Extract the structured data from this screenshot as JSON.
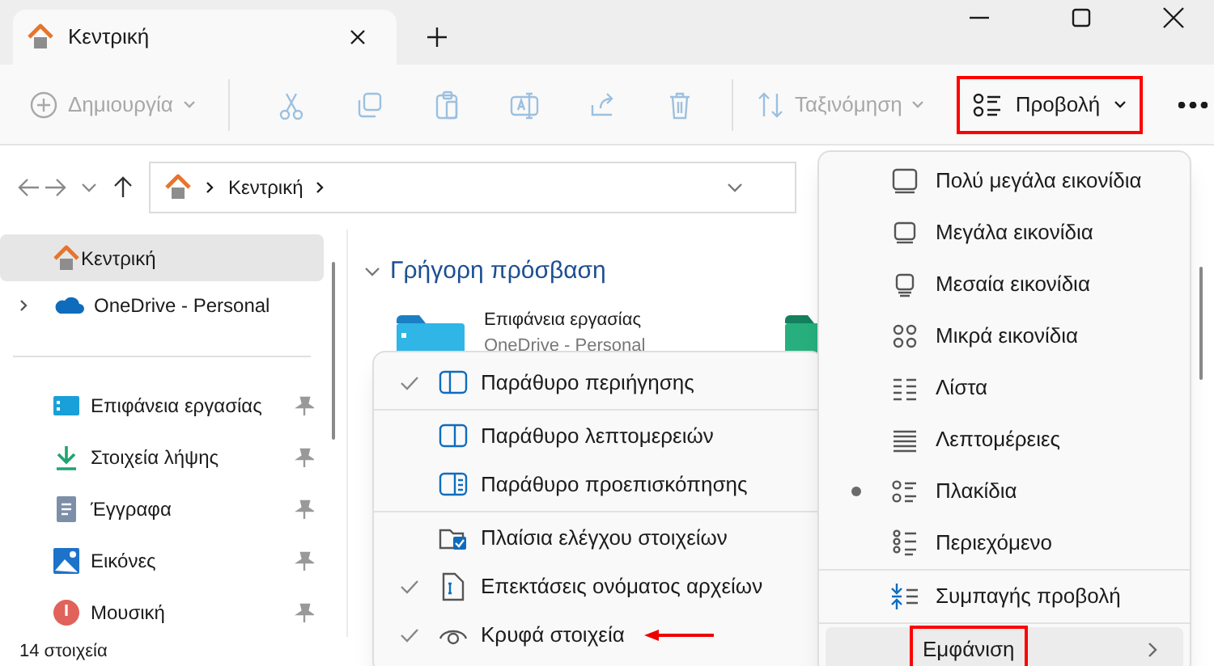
{
  "tabs": [
    {
      "label": "Κεντρική",
      "selected": true
    }
  ],
  "toolbar": {
    "new": {
      "label": "Δημιουργία",
      "disabled": true
    },
    "actions_disabled": true,
    "sort": {
      "label": "Ταξινόμηση",
      "disabled": true
    },
    "view": {
      "label": "Προβολή",
      "highlighted": true
    }
  },
  "address": {
    "crumbs": [
      "Κεντρική"
    ]
  },
  "sidebar": {
    "items": [
      {
        "label": "Κεντρική",
        "selected": true,
        "kind": "home"
      },
      {
        "label": "OneDrive - Personal",
        "selected": false,
        "kind": "cloud"
      }
    ],
    "pinned": [
      {
        "label": "Επιφάνεια εργασίας",
        "selected": false
      },
      {
        "label": "Στοιχεία λήψης",
        "selected": false
      },
      {
        "label": "Έγγραφα",
        "selected": false
      },
      {
        "label": "Εικόνες",
        "selected": false
      },
      {
        "label": "Μουσική",
        "selected": false
      }
    ]
  },
  "content": {
    "section": "Γρήγορη πρόσβαση",
    "folders": [
      {
        "name": "Επιφάνεια εργασίας",
        "location": "OneDrive - Personal"
      }
    ]
  },
  "status_bar": "14 στοιχεία",
  "view_menu": {
    "items": [
      {
        "label": "Πολύ μεγάλα εικονίδια",
        "selected": false
      },
      {
        "label": "Μεγάλα εικονίδια",
        "selected": false
      },
      {
        "label": "Μεσαία εικονίδια",
        "selected": false
      },
      {
        "label": "Μικρά εικονίδια",
        "selected": false
      },
      {
        "label": "Λίστα",
        "selected": false
      },
      {
        "label": "Λεπτομέρειες",
        "selected": false
      },
      {
        "label": "Πλακίδια",
        "selected": true
      },
      {
        "label": "Περιεχόμενο",
        "selected": false
      }
    ],
    "compact": "Συμπαγής προβολή",
    "show": {
      "label": "Εμφάνιση",
      "highlighted": true
    }
  },
  "show_menu": {
    "items": [
      {
        "label": "Παράθυρο περιήγησης",
        "checked": true,
        "annotated": false
      },
      {
        "label": "Παράθυρο λεπτομερειών",
        "checked": false,
        "annotated": false
      },
      {
        "label": "Παράθυρο προεπισκόπησης",
        "checked": false,
        "annotated": false
      },
      {
        "label": "Πλαίσια ελέγχου στοιχείων",
        "checked": false,
        "annotated": false
      },
      {
        "label": "Επεκτάσεις ονόματος αρχείων",
        "checked": true,
        "annotated": false
      },
      {
        "label": "Κρυφά στοιχεία",
        "checked": true,
        "annotated": true
      }
    ]
  }
}
